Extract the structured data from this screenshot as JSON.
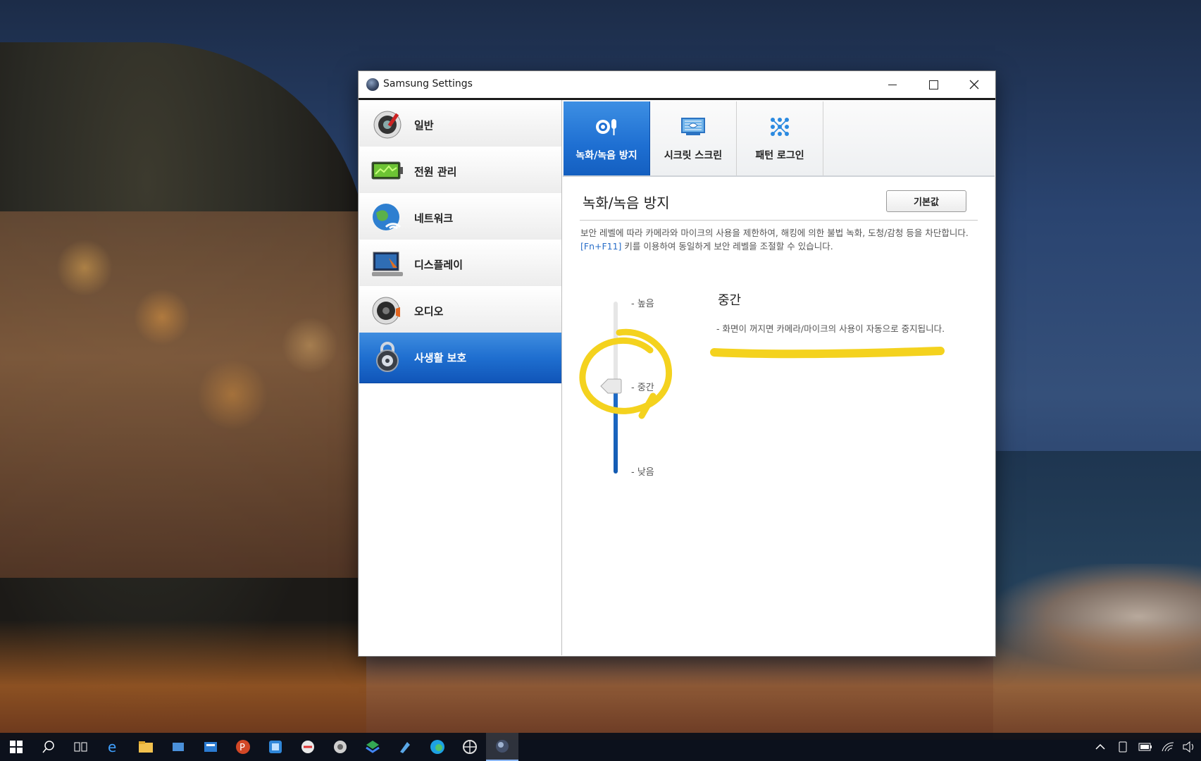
{
  "window": {
    "title": "Samsung Settings",
    "controls": {
      "minimize": "minimize",
      "maximize": "maximize",
      "close": "close"
    }
  },
  "sidebar": {
    "items": [
      {
        "label": "일반",
        "icon": "speaker-gear-icon",
        "active": false
      },
      {
        "label": "전원 관리",
        "icon": "battery-icon",
        "active": false
      },
      {
        "label": "네트워크",
        "icon": "globe-wifi-icon",
        "active": false
      },
      {
        "label": "디스플레이",
        "icon": "monitor-icon",
        "active": false
      },
      {
        "label": "오디오",
        "icon": "speaker-icon",
        "active": false
      },
      {
        "label": "사생활 보호",
        "icon": "lock-icon",
        "active": true
      }
    ]
  },
  "tabs": [
    {
      "label": "녹화/녹음 방지",
      "icon": "camera-mic-icon",
      "active": true
    },
    {
      "label": "시크릿 스크린",
      "icon": "secret-screen-icon",
      "active": false
    },
    {
      "label": "패턴 로그인",
      "icon": "pattern-grid-icon",
      "active": false
    }
  ],
  "section": {
    "title": "녹화/녹음 방지",
    "default_button": "기본값",
    "description_part1": "보안 레벨에 따라 카메라와 마이크의 사용을 제한하여, 해킹에 의한 불법 녹화, 도청/감청 등을 차단합니다. ",
    "description_hotkey": "[Fn+F11]",
    "description_part2": " 키를 이용하여 동일하게 보안 레벨을 조절할 수 있습니다."
  },
  "slider": {
    "labels": {
      "high": "- 높음",
      "mid": "- 중간",
      "low": "- 낮음"
    },
    "value": "중간",
    "level_index": 1
  },
  "level": {
    "title": "중간",
    "description": "- 화면이 꺼지면 카메라/마이크의 사용이 자동으로 중지됩니다."
  },
  "annotation": {
    "color": "#f4d21e"
  },
  "taskbar": {
    "items": [
      "windows-start-icon",
      "search-icon",
      "task-view-icon",
      "ie-icon",
      "file-explorer-icon",
      "app-icon",
      "app-icon",
      "powerpoint-icon",
      "app-icon",
      "app-icon",
      "app-icon",
      "app-icon",
      "app-icon",
      "edge-icon",
      "app-icon",
      "samsung-settings-icon"
    ],
    "tray": [
      "chevron-up-icon",
      "tablet-icon",
      "battery-icon",
      "wifi-icon",
      "volume-icon"
    ]
  },
  "colors": {
    "accent": "#1e6fd2",
    "hotkey": "#2a6fc9"
  }
}
